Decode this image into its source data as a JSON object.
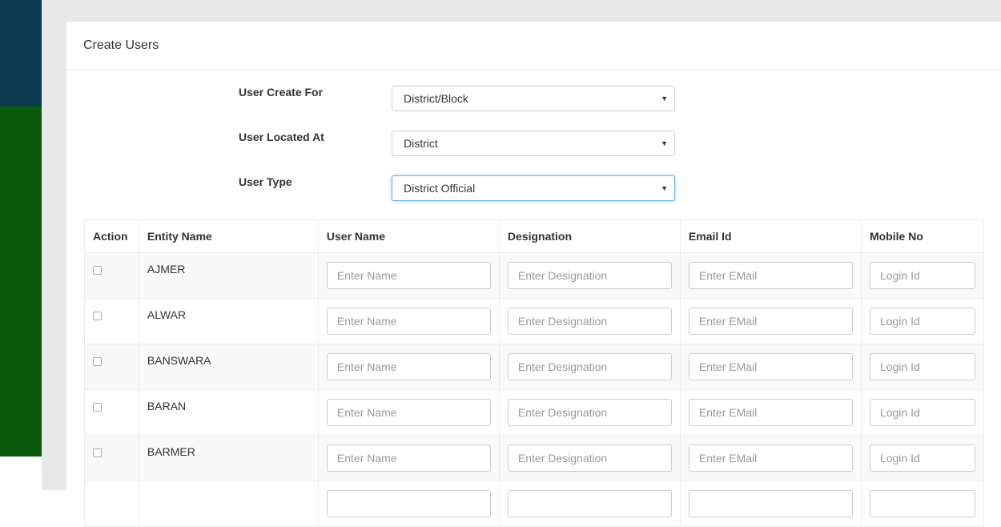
{
  "panel": {
    "title": "Create Users"
  },
  "form": {
    "user_create_for": {
      "label": "User Create For",
      "value": "District/Block"
    },
    "user_located_at": {
      "label": "User Located At",
      "value": "District"
    },
    "user_type": {
      "label": "User Type",
      "value": "District Official"
    }
  },
  "table": {
    "headers": [
      "Action",
      "Entity Name",
      "User Name",
      "Designation",
      "Email Id",
      "Mobile No"
    ],
    "placeholders": {
      "name": "Enter Name",
      "designation": "Enter Designation",
      "email": "Enter EMail",
      "mobile": "Login Id"
    },
    "rows": [
      {
        "entity": "AJMER"
      },
      {
        "entity": "ALWAR"
      },
      {
        "entity": "BANSWARA"
      },
      {
        "entity": "BARAN"
      },
      {
        "entity": "BARMER"
      }
    ]
  },
  "icons": {
    "select_caret": "caret-down-icon"
  },
  "colors": {
    "sidebar_top": "#0b3a50",
    "sidebar_bottom": "#0b5a0b",
    "focus_border": "#66afe9"
  }
}
